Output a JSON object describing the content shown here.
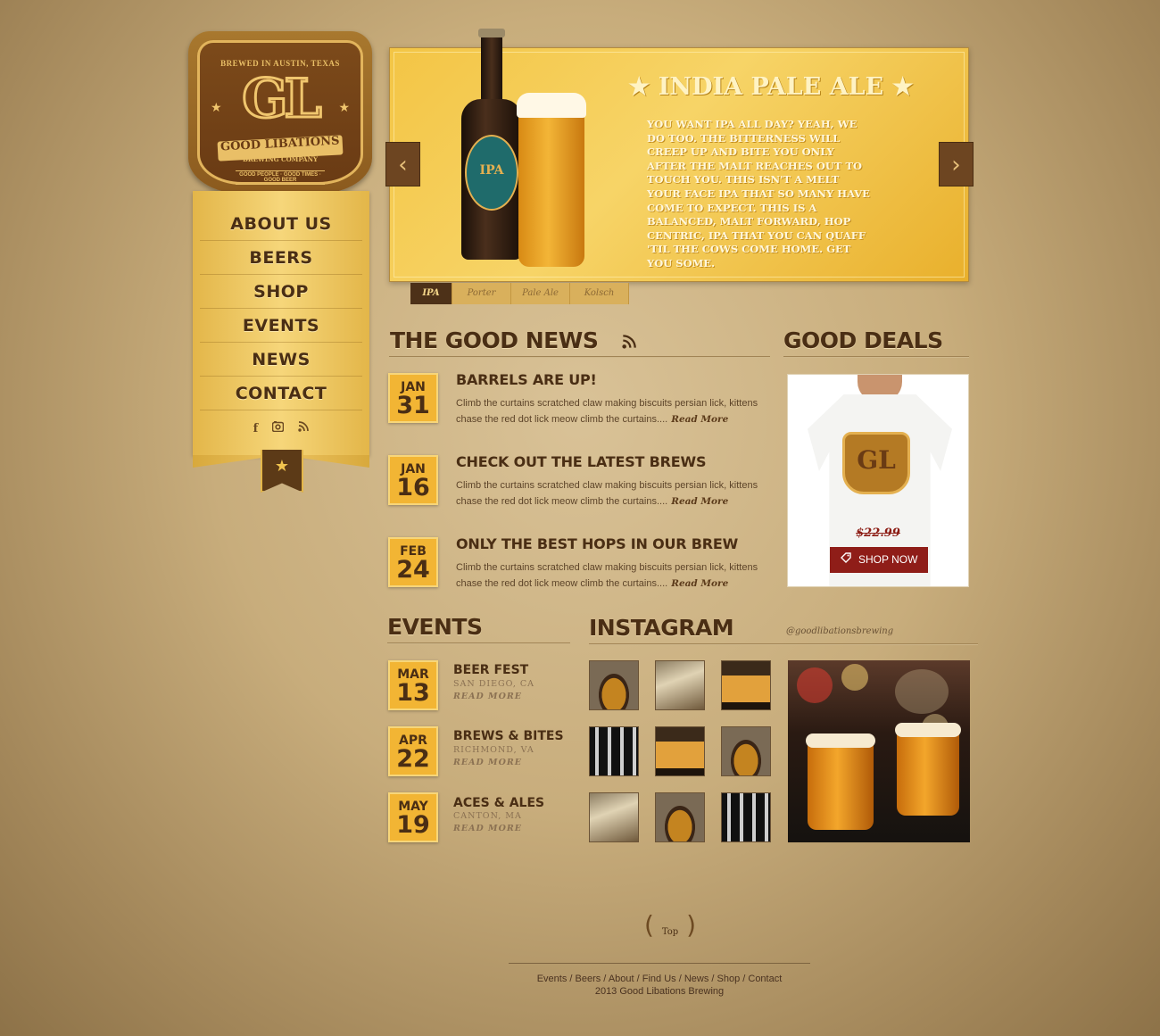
{
  "brand": {
    "top_text": "BREWED IN AUSTIN, TEXAS",
    "initials": "GL",
    "name": "GOOD LIBATIONS",
    "subname": "BREWING COMPANY",
    "tagline": "GOOD PEOPLE · GOOD TIMES · GOOD BEER"
  },
  "nav": {
    "items": [
      "ABOUT US",
      "BEERS",
      "SHOP",
      "EVENTS",
      "NEWS",
      "CONTACT"
    ],
    "social": [
      "facebook-icon",
      "instagram-icon",
      "rss-icon"
    ]
  },
  "hero": {
    "title": "★ INDIA PALE ALE ★",
    "bottle_label": "IPA",
    "copy": "YOU WANT IPA ALL DAY? YEAH, WE DO TOO. THE BITTERNESS WILL CREEP UP AND BITE YOU ONLY AFTER THE MALT REACHES OUT TO TOUCH YOU. THIS ISN'T A MELT YOUR FACE IPA THAT SO MANY HAVE COME TO EXPECT. THIS IS A BALANCED, MALT FORWARD, HOP CENTRIC, IPA THAT YOU CAN QUAFF 'TIL THE COWS COME HOME. GET YOU SOME.",
    "prev": "‹",
    "next": "›",
    "tabs": [
      "IPA",
      "Porter",
      "Pale Ale",
      "Kolsch"
    ],
    "active_tab": "IPA"
  },
  "news": {
    "heading": "THE GOOD NEWS",
    "rss_icon": "rss-icon",
    "items": [
      {
        "month": "JAN",
        "day": "31",
        "title": "BARRELS ARE UP!",
        "text": "Climb the curtains scratched claw making biscuits persian lick, kittens chase the red dot lick meow climb the curtains....",
        "more": "Read More"
      },
      {
        "month": "JAN",
        "day": "16",
        "title": "CHECK OUT THE LATEST BREWS",
        "text": "Climb the curtains scratched claw making biscuits persian lick, kittens chase the red dot lick meow climb the curtains....",
        "more": "Read More"
      },
      {
        "month": "FEB",
        "day": "24",
        "title": "ONLY THE BEST HOPS IN OUR BREW",
        "text": "Climb the curtains scratched claw making biscuits persian lick, kittens chase the red dot lick meow climb the curtains....",
        "more": "Read More"
      }
    ]
  },
  "deals": {
    "heading": "GOOD DEALS",
    "shirt_logo": "GL",
    "price": "$22.99",
    "button": "SHOP NOW",
    "button_icon": "tag-icon"
  },
  "events": {
    "heading": "EVENTS",
    "items": [
      {
        "month": "MAR",
        "day": "13",
        "title": "BEER FEST",
        "location": "SAN DIEGO, CA",
        "more": "READ MORE"
      },
      {
        "month": "APR",
        "day": "22",
        "title": "BREWS & BITES",
        "location": "RICHMOND, VA",
        "more": "READ MORE"
      },
      {
        "month": "MAY",
        "day": "19",
        "title": "ACES & ALES",
        "location": "CANTON, MA",
        "more": "READ MORE"
      }
    ]
  },
  "instagram": {
    "heading": "INSTAGRAM",
    "handle": "@goodlibationsbrewing"
  },
  "footer": {
    "top": "Top",
    "links": [
      "Events",
      "Beers",
      "About",
      "Find Us",
      "News",
      "Shop",
      "Contact"
    ],
    "copyright": "2013 Good Libations Brewing"
  }
}
